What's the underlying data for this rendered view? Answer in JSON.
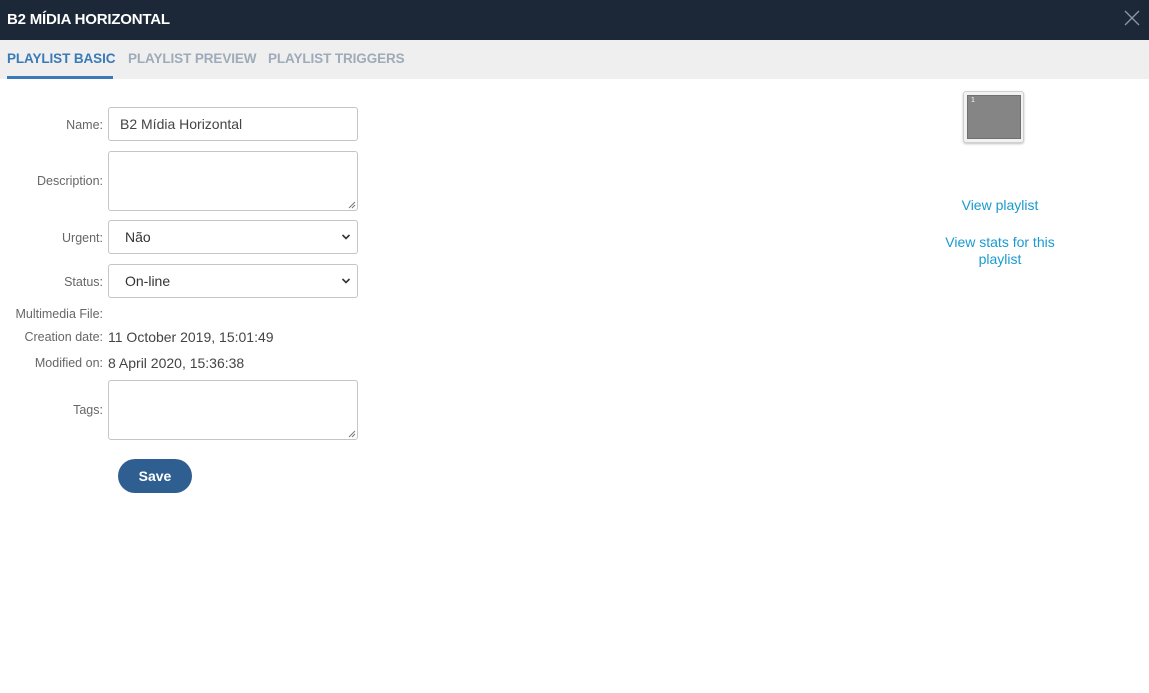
{
  "window": {
    "title": "B2 MÍDIA HORIZONTAL"
  },
  "tabs": [
    {
      "label": "PLAYLIST BASIC",
      "active": true
    },
    {
      "label": "PLAYLIST PREVIEW",
      "active": false
    },
    {
      "label": "PLAYLIST TRIGGERS",
      "active": false
    }
  ],
  "form": {
    "name_label": "Name:",
    "name_value": "B2 Mídia Horizontal",
    "description_label": "Description:",
    "description_value": "",
    "urgent_label": "Urgent:",
    "urgent_value": "Não",
    "status_label": "Status:",
    "status_value": "On-line",
    "multimedia_label": "Multimedia File:",
    "creation_label": "Creation date:",
    "creation_value": "11 October 2019, 15:01:49",
    "modified_label": "Modified on:",
    "modified_value": "8 April 2020, 15:36:38",
    "tags_label": "Tags:",
    "tags_value": "",
    "save_label": "Save"
  },
  "preview": {
    "zone_number": "1",
    "view_playlist": "View playlist",
    "view_stats": "View stats for this playlist"
  },
  "colors": {
    "titlebar": "#1c2837",
    "tab_active": "#3a7ab8",
    "tab_inactive": "#9eabb8",
    "button": "#2f5f91",
    "link": "#1a9acf"
  }
}
